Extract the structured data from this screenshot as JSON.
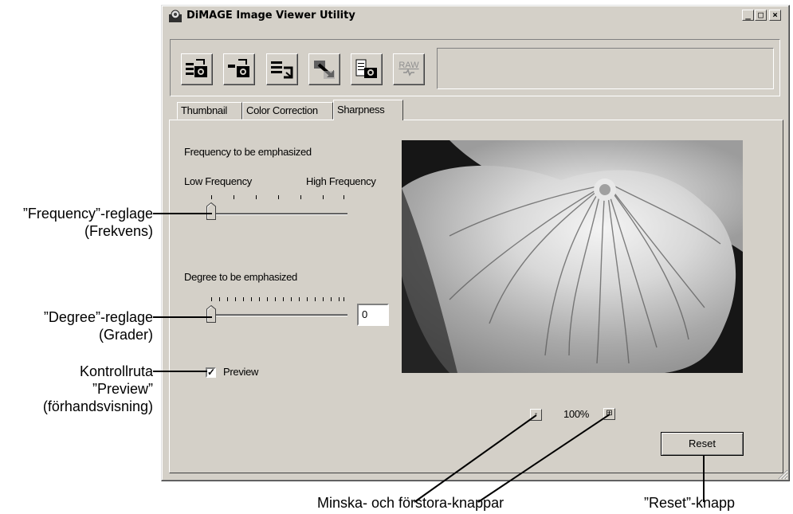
{
  "window": {
    "title": "DiMAGE Image Viewer Utility",
    "controls": [
      "_",
      "□",
      "×"
    ]
  },
  "toolbar": {
    "buttons": [
      {
        "icon": "open-camera-icon"
      },
      {
        "icon": "save-camera-icon"
      },
      {
        "icon": "batch-camera-icon"
      },
      {
        "icon": "convert-icon"
      },
      {
        "icon": "camera-settings-icon"
      },
      {
        "icon": "raw-icon",
        "label": "RAW"
      }
    ]
  },
  "tabs": [
    "Thumbnail",
    "Color Correction",
    "Sharpness"
  ],
  "active_tab": "Sharpness",
  "sharpness": {
    "frequency_heading": "Frequency to be emphasized",
    "low_label": "Low Frequency",
    "high_label": "High Frequency",
    "frequency_value": 0,
    "degree_heading": "Degree to be emphasized",
    "degree_value": "0",
    "preview_label": "Preview",
    "preview_checked": true,
    "preview_check_glyph": "✓"
  },
  "zoom": {
    "minus": "-",
    "level": "100%",
    "plus": "⊞"
  },
  "reset_label": "Reset",
  "annotations": {
    "frequency_slider": [
      "”Frequency”-reglage",
      "(Frekvens)"
    ],
    "degree_slider": [
      "”Degree”-reglage",
      "(Grader)"
    ],
    "preview_checkbox": [
      "Kontrollruta",
      "”Preview”",
      "(förhandsvisning)"
    ],
    "zoom_buttons": "Minska- och förstora-knappar",
    "reset_button": "”Reset”-knapp"
  },
  "colors": {
    "face": "#d4d0c8",
    "shadow": "#808080",
    "highlight": "#ffffff"
  }
}
